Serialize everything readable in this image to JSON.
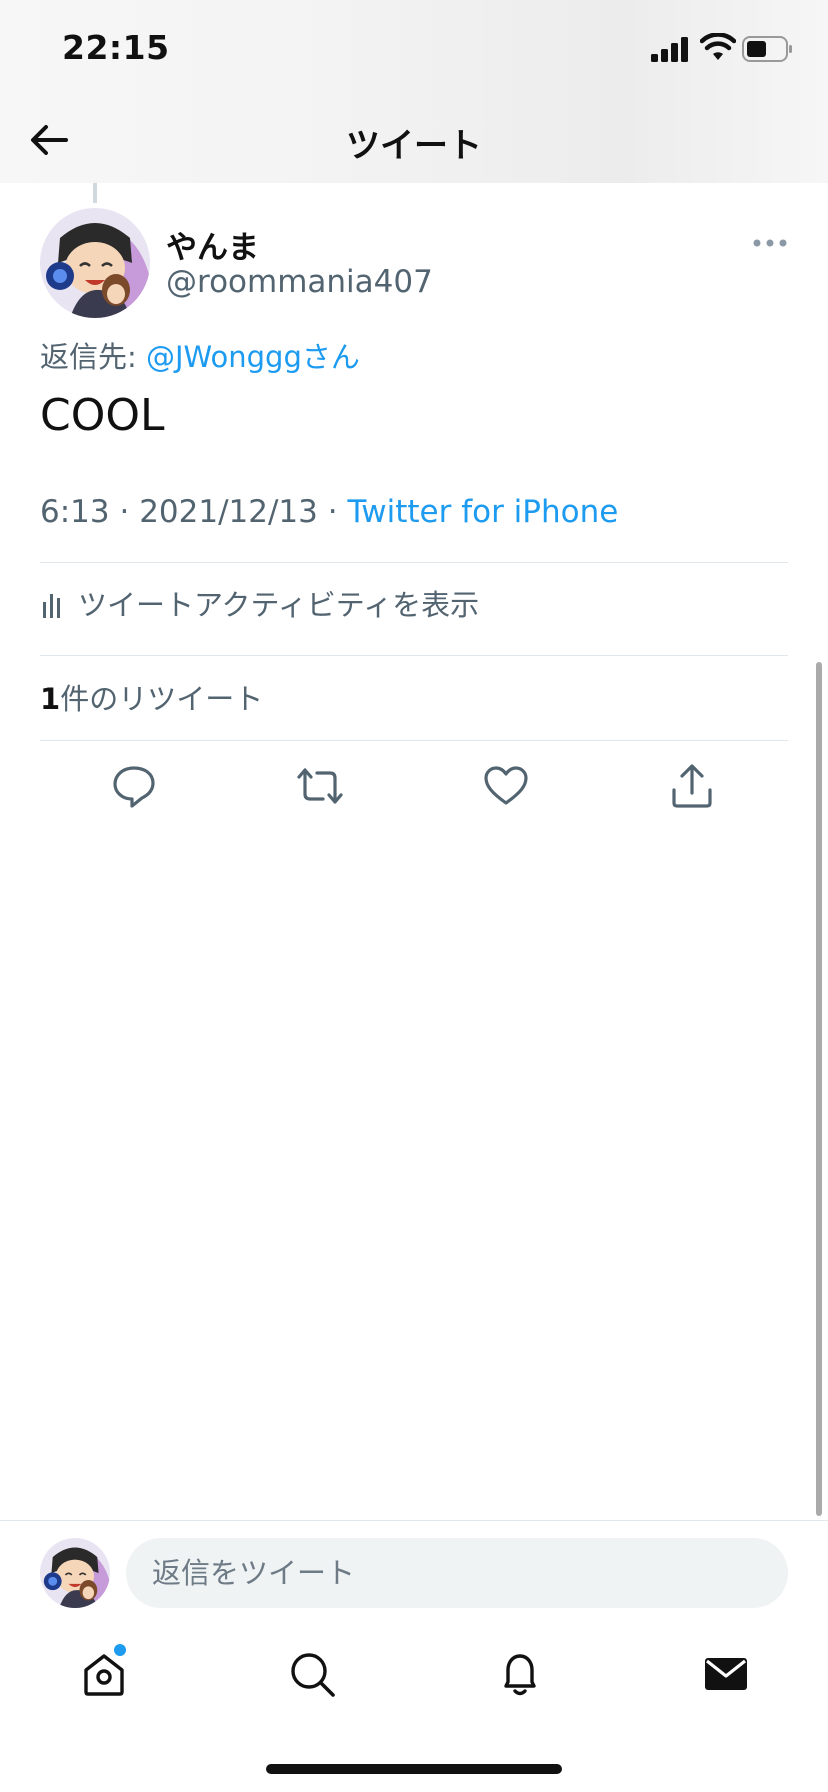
{
  "status_bar": {
    "time": "22:15"
  },
  "nav": {
    "title": "ツイート"
  },
  "tweet": {
    "display_name": "やんま",
    "handle": "@roommania407",
    "reply_prefix": "返信先: ",
    "reply_mention": "@JWonggg",
    "reply_suffix": "さん",
    "text": "COOL",
    "time": "6:13",
    "date": "2021/12/13",
    "separator": " · ",
    "source": "Twitter for iPhone",
    "activity_label": "ツイートアクティビティを表示",
    "retweet_count": "1",
    "retweet_label": "件のリツイート"
  },
  "reply_bar": {
    "placeholder": "返信をツイート"
  },
  "tabs": {
    "items": [
      "home-icon",
      "search-icon",
      "bell-icon",
      "mail-icon"
    ],
    "home_has_new": true
  },
  "colors": {
    "accent": "#1d9bf0",
    "secondary_text": "#536471",
    "divider": "#e1e8ed"
  }
}
